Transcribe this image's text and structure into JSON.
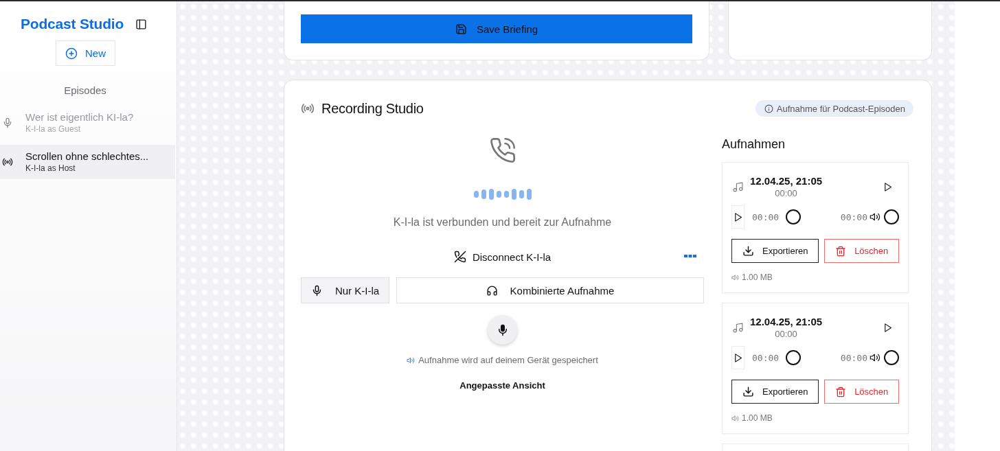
{
  "sidebar": {
    "title": "Podcast Studio",
    "new_button": "New",
    "section_title": "Episodes",
    "episodes": [
      {
        "title": "Wer ist eigentlich KI-la?",
        "subtitle": "K-I-la as Guest",
        "kind": "microphone",
        "selected": false
      },
      {
        "title": "Scrollen ohne schlechtes...",
        "subtitle": "K-I-la as Host",
        "kind": "broadcast",
        "selected": true
      }
    ]
  },
  "briefing": {
    "save_button": "Save Briefing"
  },
  "studio": {
    "title": "Recording Studio",
    "badge": "Aufnahme für Podcast-Episoden",
    "status": "K-I-la ist verbunden und bereit zur Aufnahme",
    "disconnect_button": "Disconnect K-I-la",
    "modes": [
      {
        "label": "Nur K-I-la",
        "kind": "microphone",
        "selected": true
      },
      {
        "label": "Kombinierte Aufnahme",
        "kind": "headphones",
        "selected": false
      }
    ],
    "storage_note": "Aufnahme wird auf deinem Gerät gespeichert",
    "view_link": "Angepasste Ansicht"
  },
  "recordings": {
    "title": "Aufnahmen",
    "items": [
      {
        "date": "12.04.25, 21:05",
        "duration": "00:00",
        "current_time": "00:00",
        "total_time": "00:00",
        "export_button": "Exportieren",
        "delete_button": "Löschen",
        "size": "1.00 MB"
      },
      {
        "date": "12.04.25, 21:05",
        "duration": "00:00",
        "current_time": "00:00",
        "total_time": "00:00",
        "export_button": "Exportieren",
        "delete_button": "Löschen",
        "size": "1.00 MB"
      }
    ]
  }
}
